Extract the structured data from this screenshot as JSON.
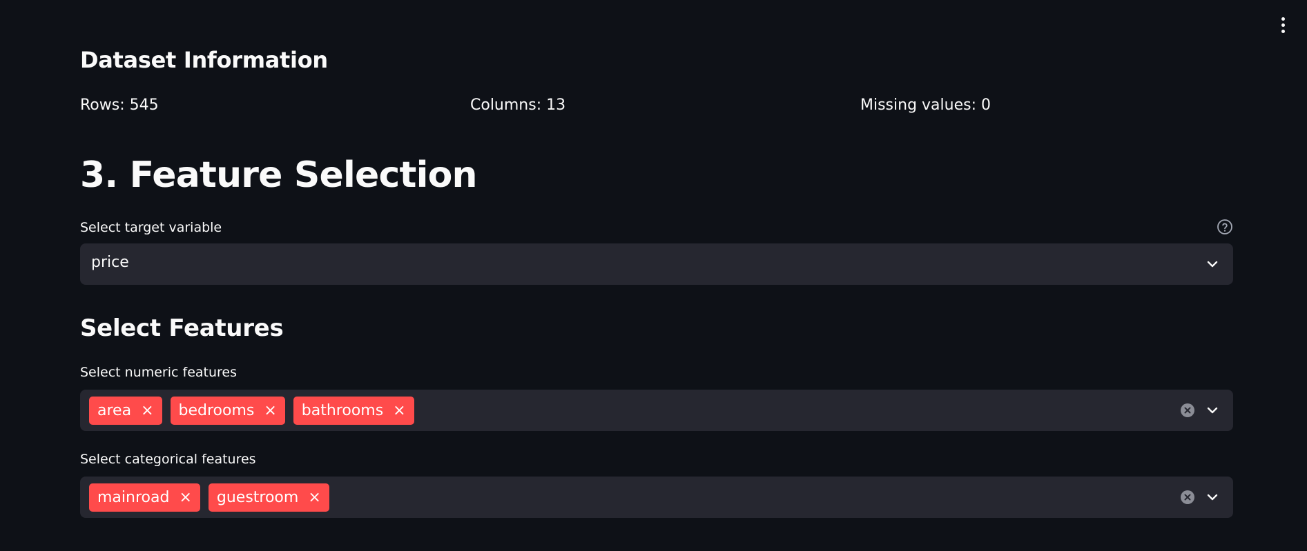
{
  "app_menu": {
    "icon": "more-vertical-icon"
  },
  "dataset_info": {
    "heading": "Dataset Information",
    "rows": "Rows: 545",
    "columns": "Columns: 13",
    "missing": "Missing values: 0"
  },
  "feature_selection": {
    "heading": "3. Feature Selection",
    "target": {
      "label": "Select target variable",
      "value": "price",
      "help_icon": "help-circle-icon"
    },
    "select_features_heading": "Select Features",
    "numeric": {
      "label": "Select numeric features",
      "tags": [
        "area",
        "bedrooms",
        "bathrooms"
      ]
    },
    "categorical": {
      "label": "Select categorical features",
      "tags": [
        "mainroad",
        "guestroom"
      ]
    },
    "tag_remove_glyph": "×"
  },
  "colors": {
    "background": "#0e1117",
    "input_background": "#262730",
    "tag_background": "#ff4b4b",
    "text": "#fafafa"
  }
}
